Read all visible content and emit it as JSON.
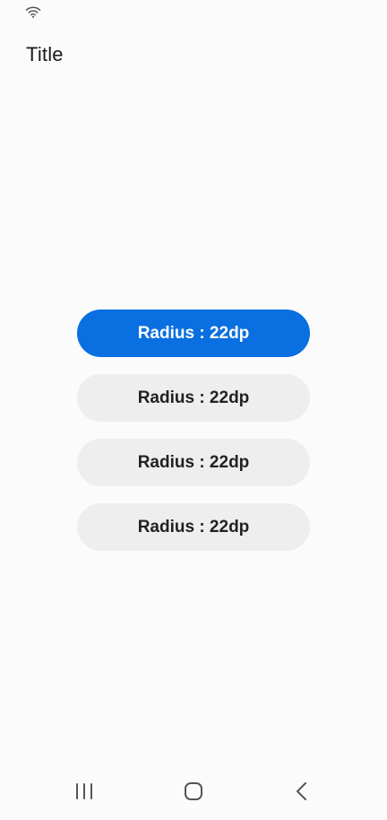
{
  "status_bar": {
    "icons": [
      "wifi-icon"
    ]
  },
  "header": {
    "title": "Title"
  },
  "buttons": [
    {
      "label": "Radius : 22dp",
      "variant": "primary",
      "color": "#0a6fe0"
    },
    {
      "label": "Radius : 22dp",
      "variant": "secondary",
      "color": "#eeeeee"
    },
    {
      "label": "Radius : 22dp",
      "variant": "secondary",
      "color": "#eeeeee"
    },
    {
      "label": "Radius : 22dp",
      "variant": "secondary",
      "color": "#eeeeee"
    }
  ],
  "nav_bar": {
    "icons": [
      "recents-icon",
      "home-icon",
      "back-icon"
    ]
  }
}
